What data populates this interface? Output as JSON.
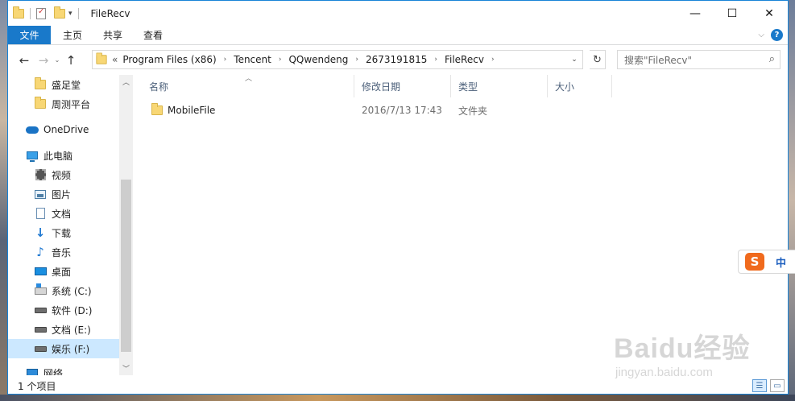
{
  "window": {
    "title": "FileRecv"
  },
  "window_controls": {
    "minimize": "—",
    "maximize": "☐",
    "close": "✕"
  },
  "ribbon": {
    "file_tab": "文件",
    "tabs": [
      "主页",
      "共享",
      "查看"
    ],
    "accent": "#1979ca"
  },
  "address": {
    "lead": "«",
    "crumbs": [
      "Program Files (x86)",
      "Tencent",
      "QQwendeng",
      "2673191815",
      "FileRecv"
    ]
  },
  "search": {
    "placeholder": "搜索\"FileRecv\""
  },
  "nav": {
    "quick": [
      {
        "label": "盛足堂",
        "icon": "folder-icon"
      },
      {
        "label": "周测平台",
        "icon": "folder-icon"
      }
    ],
    "onedrive": "OneDrive",
    "pc": "此电脑",
    "pc_items": [
      {
        "label": "视频",
        "icon": "video-icon"
      },
      {
        "label": "图片",
        "icon": "picture-icon"
      },
      {
        "label": "文档",
        "icon": "document-icon"
      },
      {
        "label": "下载",
        "icon": "download-icon"
      },
      {
        "label": "音乐",
        "icon": "music-icon"
      },
      {
        "label": "桌面",
        "icon": "desktop-icon"
      },
      {
        "label": "系统 (C:)",
        "icon": "system-drive-icon"
      },
      {
        "label": "软件 (D:)",
        "icon": "drive-icon"
      },
      {
        "label": "文档 (E:)",
        "icon": "drive-icon"
      },
      {
        "label": "娱乐 (F:)",
        "icon": "drive-icon"
      }
    ],
    "network": "网络"
  },
  "columns": {
    "name": "名称",
    "date": "修改日期",
    "type": "类型",
    "size": "大小"
  },
  "files": [
    {
      "name": "MobileFile",
      "date": "2016/7/13 17:43",
      "type": "文件夹",
      "size": ""
    }
  ],
  "status": {
    "count": "1 个项目"
  },
  "ime": {
    "lang": "中"
  },
  "watermark": {
    "main": "Baidu经验",
    "sub": "jingyan.baidu.com"
  }
}
